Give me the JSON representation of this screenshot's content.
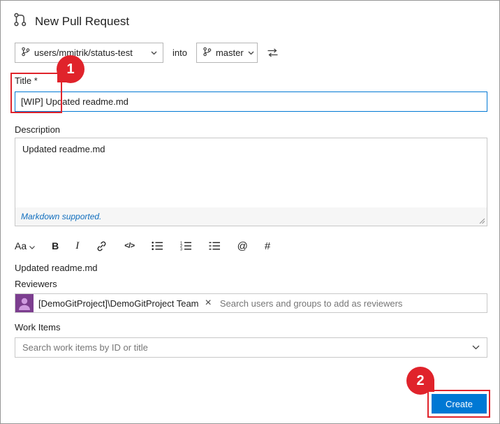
{
  "window": {
    "title": "New Pull Request"
  },
  "branch_bar": {
    "source_branch": "users/mmitrik/status-test",
    "into_label": "into",
    "target_branch": "master"
  },
  "form": {
    "title": {
      "label": "Title *",
      "value": "[WIP] Updated readme.md"
    },
    "description": {
      "label": "Description",
      "value": "Updated readme.md",
      "markdown_note": "Markdown supported."
    },
    "preview_text": "Updated readme.md",
    "reviewers": {
      "label": "Reviewers",
      "selected_reviewer": "[DemoGitProject]\\DemoGitProject Team",
      "placeholder": "Search users and groups to add as reviewers"
    },
    "work_items": {
      "label": "Work Items",
      "placeholder": "Search work items by ID or title"
    }
  },
  "toolbar": {
    "format_label": "Aa",
    "bold_label": "B",
    "italic_label": "I",
    "code_label": "</>",
    "mention_label": "@",
    "work_item_label": "#"
  },
  "actions": {
    "create_label": "Create"
  },
  "annotations": {
    "step_1": "1",
    "step_2": "2"
  },
  "icons": {
    "remove_glyph": "×"
  },
  "colors": {
    "accent_blue": "#0078d4",
    "annotation_red": "#e0232b",
    "link_blue": "#106ebe"
  }
}
